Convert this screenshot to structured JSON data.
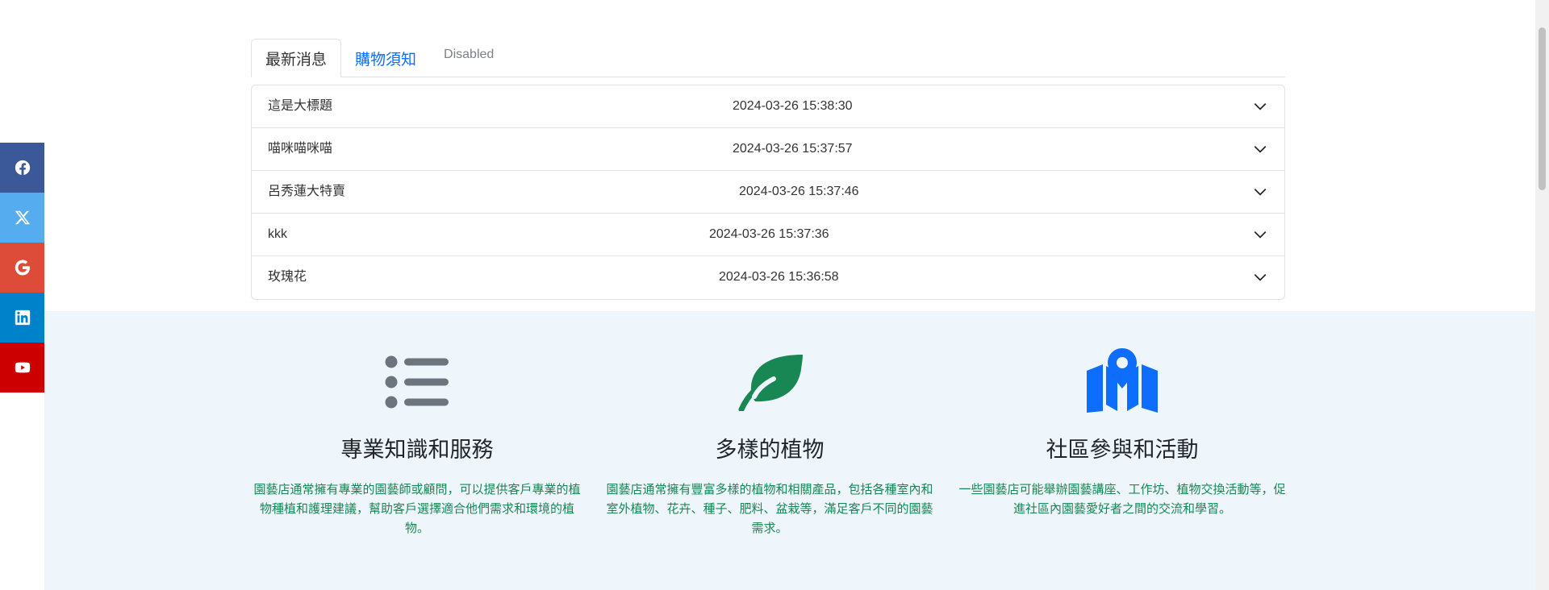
{
  "social": {
    "items": [
      {
        "name": "facebook",
        "icon": "facebook-icon",
        "color": "#3b5998"
      },
      {
        "name": "x",
        "icon": "x-icon",
        "color": "#55acee"
      },
      {
        "name": "google",
        "icon": "google-icon",
        "color": "#dd4b39"
      },
      {
        "name": "linkedin",
        "icon": "linkedin-icon",
        "color": "#0082ca"
      },
      {
        "name": "youtube",
        "icon": "youtube-icon",
        "color": "#ed302f"
      }
    ]
  },
  "tabs": [
    {
      "label": "最新消息",
      "state": "active"
    },
    {
      "label": "購物須知",
      "state": "link"
    },
    {
      "label": "Disabled",
      "state": "disabled"
    }
  ],
  "accordion": {
    "items": [
      {
        "title": "這是大標題",
        "date": "2024-03-26 15:38:30"
      },
      {
        "title": "喵咪喵咪喵",
        "date": "2024-03-26 15:37:57"
      },
      {
        "title": "呂秀蓮大特賣",
        "date": "2024-03-26 15:37:46"
      },
      {
        "title": "kkk",
        "date": "2024-03-26 15:37:36"
      },
      {
        "title": "玫瑰花",
        "date": "2024-03-26 15:36:58"
      }
    ]
  },
  "features": [
    {
      "icon": "list-icon",
      "icon_color": "#6c757d",
      "title": "專業知識和服務",
      "description": "園藝店通常擁有專業的園藝師或顧問，可以提供客戶專業的植物種植和護理建議，幫助客戶選擇適合他們需求和環境的植物。"
    },
    {
      "icon": "leaf-icon",
      "icon_color": "#198754",
      "title": "多樣的植物",
      "description": "園藝店通常擁有豐富多樣的植物和相關產品，包括各種室內和室外植物、花卉、種子、肥料、盆栽等，滿足客戶不同的園藝需求。"
    },
    {
      "icon": "map-location-icon",
      "icon_color": "#0d6efd",
      "title": "社區參與和活動",
      "description": "一些園藝店可能舉辦園藝講座、工作坊、植物交換活動等，促進社區內園藝愛好者之間的交流和學習。"
    }
  ]
}
